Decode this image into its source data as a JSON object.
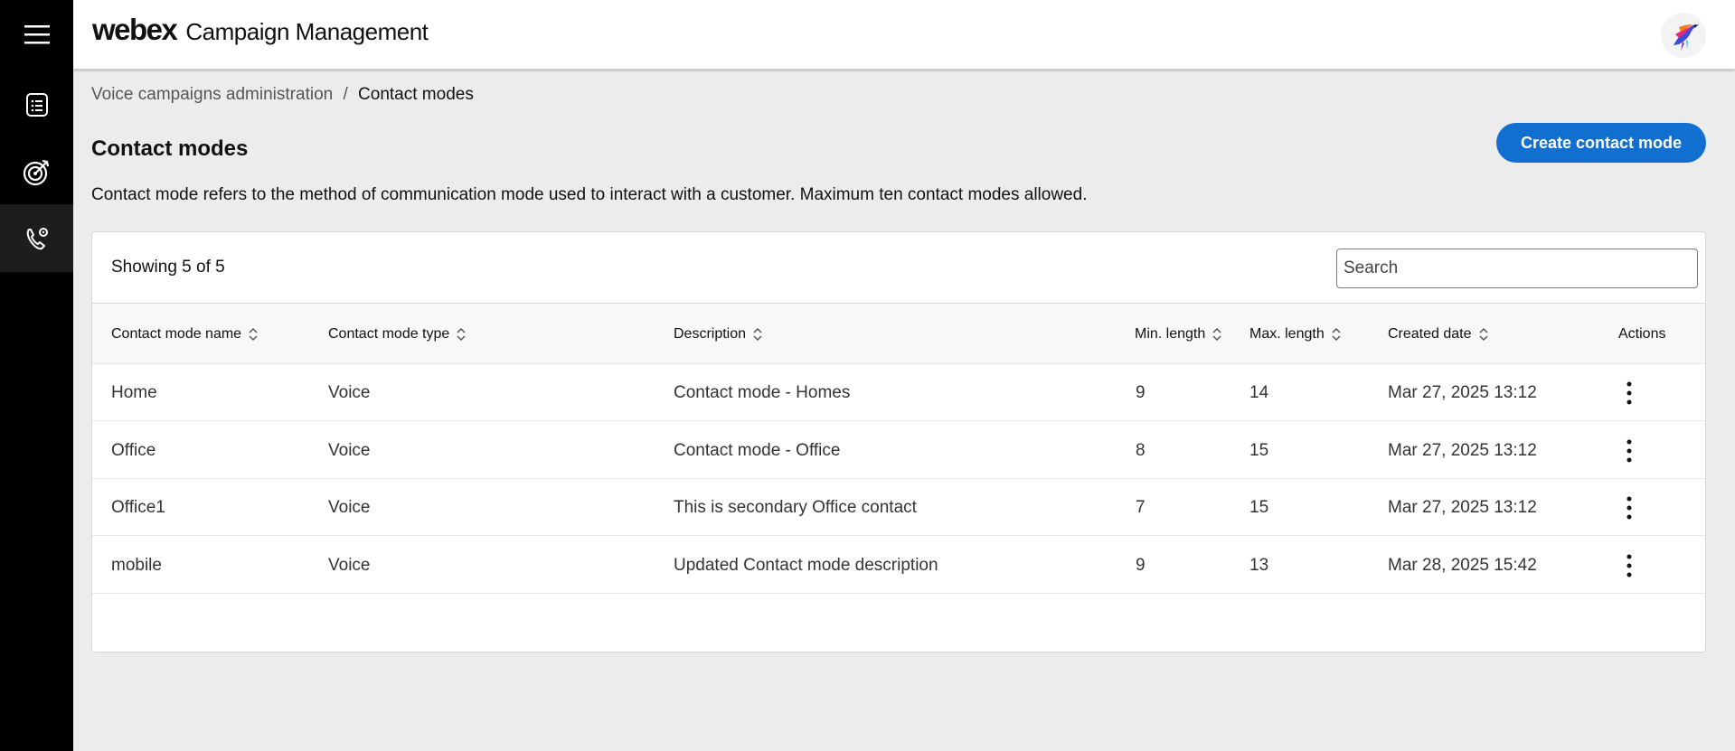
{
  "app": {
    "logo": "webex",
    "title": "Campaign Management"
  },
  "rail": {
    "items": [
      {
        "icon": "menu-icon"
      },
      {
        "icon": "list-document-icon"
      },
      {
        "icon": "target-icon"
      },
      {
        "icon": "phone-settings-icon",
        "active": true
      }
    ]
  },
  "breadcrumb": {
    "parent": "Voice campaigns administration",
    "separator": "/",
    "current": "Contact modes"
  },
  "page": {
    "title": "Contact modes",
    "description": "Contact mode refers to the method of communication mode used to interact with a customer. Maximum ten contact modes allowed.",
    "create_button": "Create contact mode"
  },
  "table": {
    "showing": "Showing 5 of 5",
    "search_placeholder": "Search",
    "columns": [
      "Contact mode name",
      "Contact mode type",
      "Description",
      "Min. length",
      "Max. length",
      "Created date",
      "Actions"
    ],
    "rows": [
      {
        "name": "Home",
        "type": "Voice",
        "description": "Contact mode - Homes",
        "min": "9",
        "max": "14",
        "created": "Mar 27, 2025 13:12"
      },
      {
        "name": "Office",
        "type": "Voice",
        "description": "Contact mode - Office",
        "min": "8",
        "max": "15",
        "created": "Mar 27, 2025 13:12"
      },
      {
        "name": "Office1",
        "type": "Voice",
        "description": "This is secondary Office contact",
        "min": "7",
        "max": "15",
        "created": "Mar 27, 2025 13:12"
      },
      {
        "name": "mobile",
        "type": "Voice",
        "description": "Updated Contact mode description",
        "min": "9",
        "max": "13",
        "created": "Mar 28, 2025 15:42"
      }
    ]
  },
  "colors": {
    "accent": "#1170cf",
    "rail_bg": "#000000",
    "page_bg": "#ececec"
  }
}
